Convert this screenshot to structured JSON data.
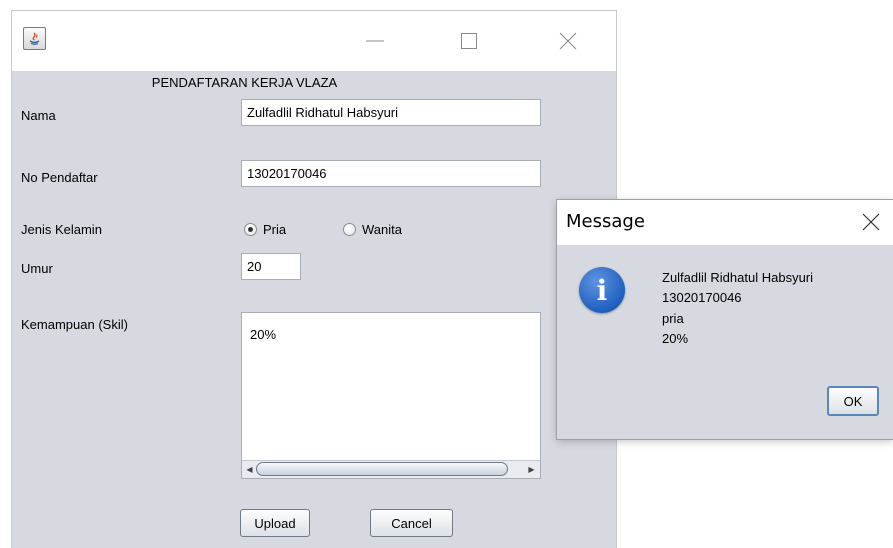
{
  "main_window": {
    "form_title": "PENDAFTARAN KERJA VLAZA",
    "labels": {
      "nama": "Nama",
      "no_pendaftar": "No Pendaftar",
      "jenis_kelamin": "Jenis Kelamin",
      "umur": "Umur",
      "kemampuan": "Kemampuan (Skil)"
    },
    "fields": {
      "nama_value": "Zulfadlil Ridhatul Habsyuri",
      "no_pendaftar_value": "13020170046",
      "umur_value": "20",
      "kemampuan_value": "20%"
    },
    "gender_options": [
      {
        "label": "Pria",
        "selected": true
      },
      {
        "label": "Wanita",
        "selected": false
      }
    ],
    "buttons": {
      "upload": "Upload",
      "cancel": "Cancel"
    }
  },
  "message_dialog": {
    "title": "Message",
    "lines": [
      "Zulfadlil Ridhatul Habsyuri",
      "13020170046",
      "pria",
      "20%"
    ],
    "ok_label": "OK",
    "icon": "info-icon"
  },
  "colors": {
    "window_bg": "#d6d9df",
    "info_icon": "#1f5fbf"
  }
}
